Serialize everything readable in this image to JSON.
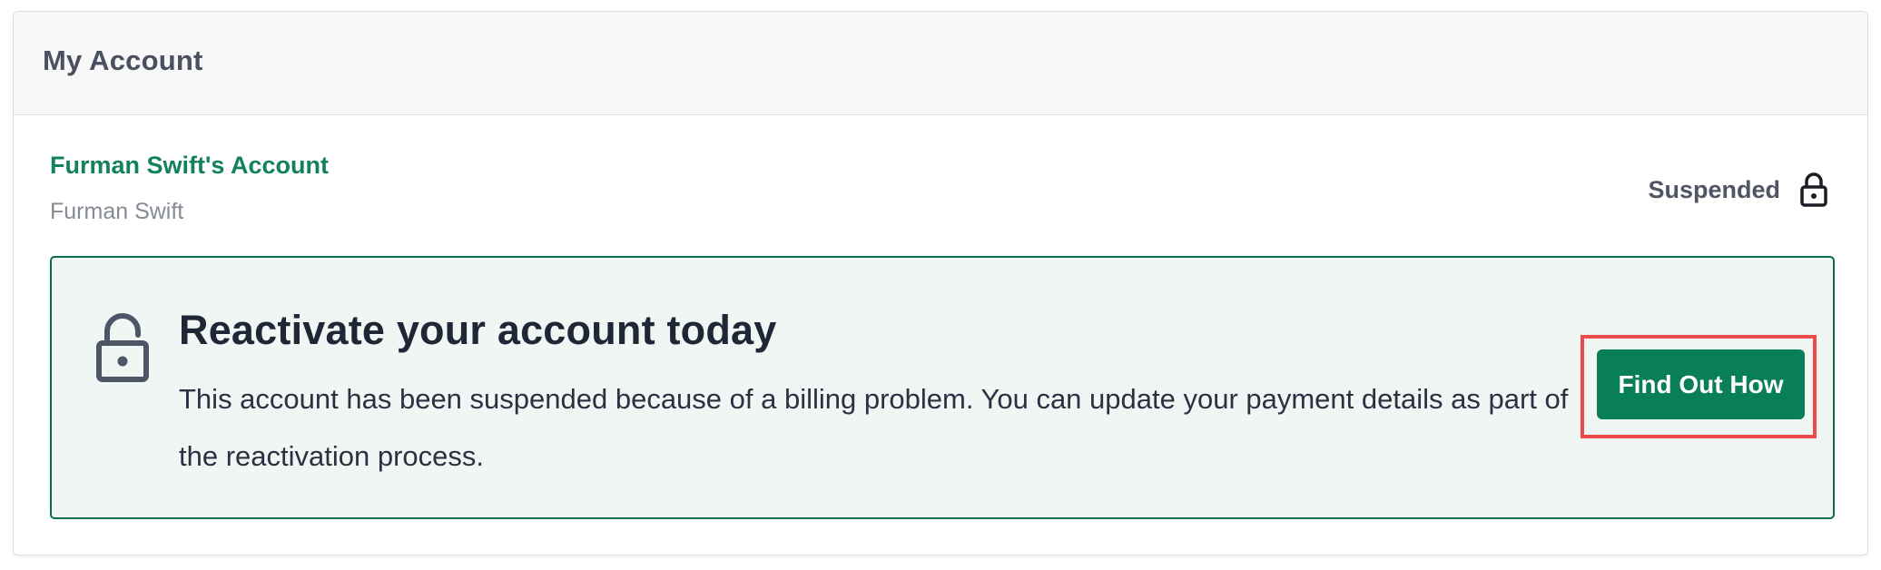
{
  "header": {
    "title": "My Account"
  },
  "account": {
    "name": "Furman Swift's Account",
    "owner": "Furman Swift",
    "status": "Suspended",
    "status_icon": "lock-icon"
  },
  "banner": {
    "icon": "unlock-icon",
    "title": "Reactivate your account today",
    "message": "This account has been suspended because of a billing problem. You can update your payment details as part of the reactivation process.",
    "cta_label": "Find Out How"
  },
  "colors": {
    "accent_green": "#087e59",
    "account_link_green": "#12825d",
    "banner_border": "#0f6c4c",
    "banner_background": "#eff6f3",
    "highlight_red": "#ee4b4b"
  }
}
